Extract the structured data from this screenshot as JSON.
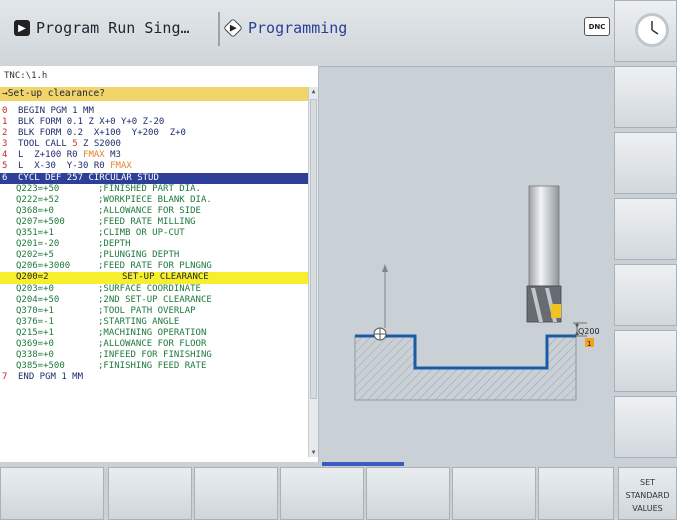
{
  "header": {
    "mode_run": "Program Run Sing…",
    "mode_prog": "Programming",
    "dnc": "DNC"
  },
  "program": {
    "path": "TNC:\\1.h",
    "prompt": "→Set-up clearance?",
    "lines": [
      {
        "n": "0",
        "parts": [
          {
            "t": "BEGIN PGM 1 MM"
          }
        ]
      },
      {
        "n": "1",
        "parts": [
          {
            "t": "BLK FORM 0.1 Z X+0 Y+0 Z-20"
          }
        ]
      },
      {
        "n": "2",
        "parts": [
          {
            "t": "BLK FORM 0.2  X+100  Y+200  Z+0"
          }
        ]
      },
      {
        "n": "3",
        "parts": [
          {
            "t": "TOOL CALL "
          },
          {
            "t": "5",
            "c": "red"
          },
          {
            "t": " Z S2000"
          }
        ]
      },
      {
        "n": "4",
        "parts": [
          {
            "t": "L  Z+100 R0 "
          },
          {
            "t": "FMAX",
            "c": "amber"
          },
          {
            "t": " M3"
          }
        ]
      },
      {
        "n": "5",
        "parts": [
          {
            "t": "L  X-30  Y-30 R0 "
          },
          {
            "t": "FMAX",
            "c": "amber"
          }
        ]
      },
      {
        "n": "6",
        "sel": true,
        "parts": [
          {
            "t": "CYCL DEF 257 CIRCULAR STUD"
          }
        ]
      }
    ],
    "params": [
      {
        "name": "Q223=+50",
        "comment": ";FINISHED PART DIA."
      },
      {
        "name": "Q222=+52",
        "comment": ";WORKPIECE BLANK DIA."
      },
      {
        "name": "Q368=+0",
        "comment": ";ALLOWANCE FOR SIDE"
      },
      {
        "name": "Q207=+500",
        "comment": ";FEED RATE MILLING"
      },
      {
        "name": "Q351=+1",
        "comment": ";CLIMB OR UP-CUT"
      },
      {
        "name": "Q201=-20",
        "comment": ";DEPTH"
      },
      {
        "name": "Q202=+5",
        "comment": ";PLUNGING DEPTH"
      },
      {
        "name": "Q206=+3000",
        "comment": ";FEED RATE FOR PLNGNG"
      },
      {
        "name": "Q200=2",
        "comment": "SET-UP CLEARANCE",
        "hl": true
      },
      {
        "name": "Q203=+0",
        "comment": ";SURFACE COORDINATE"
      },
      {
        "name": "Q204=+50",
        "comment": ";2ND SET-UP CLEARANCE"
      },
      {
        "name": "Q370=+1",
        "comment": ";TOOL PATH OVERLAP"
      },
      {
        "name": "Q376=-1",
        "comment": ";STARTING ANGLE"
      },
      {
        "name": "Q215=+1",
        "comment": ";MACHINING OPERATION"
      },
      {
        "name": "Q369=+0",
        "comment": ";ALLOWANCE FOR FLOOR"
      },
      {
        "name": "Q338=+0",
        "comment": ";INFEED FOR FINISHING"
      },
      {
        "name": "Q385=+500",
        "comment": ";FINISHING FEED RATE"
      }
    ],
    "end_line": {
      "n": "7",
      "text": "END PGM 1 MM"
    }
  },
  "graphic": {
    "q_label": "Q200",
    "marker": "1"
  },
  "softkeys": {
    "set_standard_values": "SET STANDARD VALUES"
  },
  "colors": {
    "selected_line": "#2e3f9a",
    "highlight_param": "#f7ef2c",
    "prompt_bar": "#f1d46a",
    "contour_blue": "#1d5aa6",
    "tool_tip_yellow": "#f2c21e"
  }
}
